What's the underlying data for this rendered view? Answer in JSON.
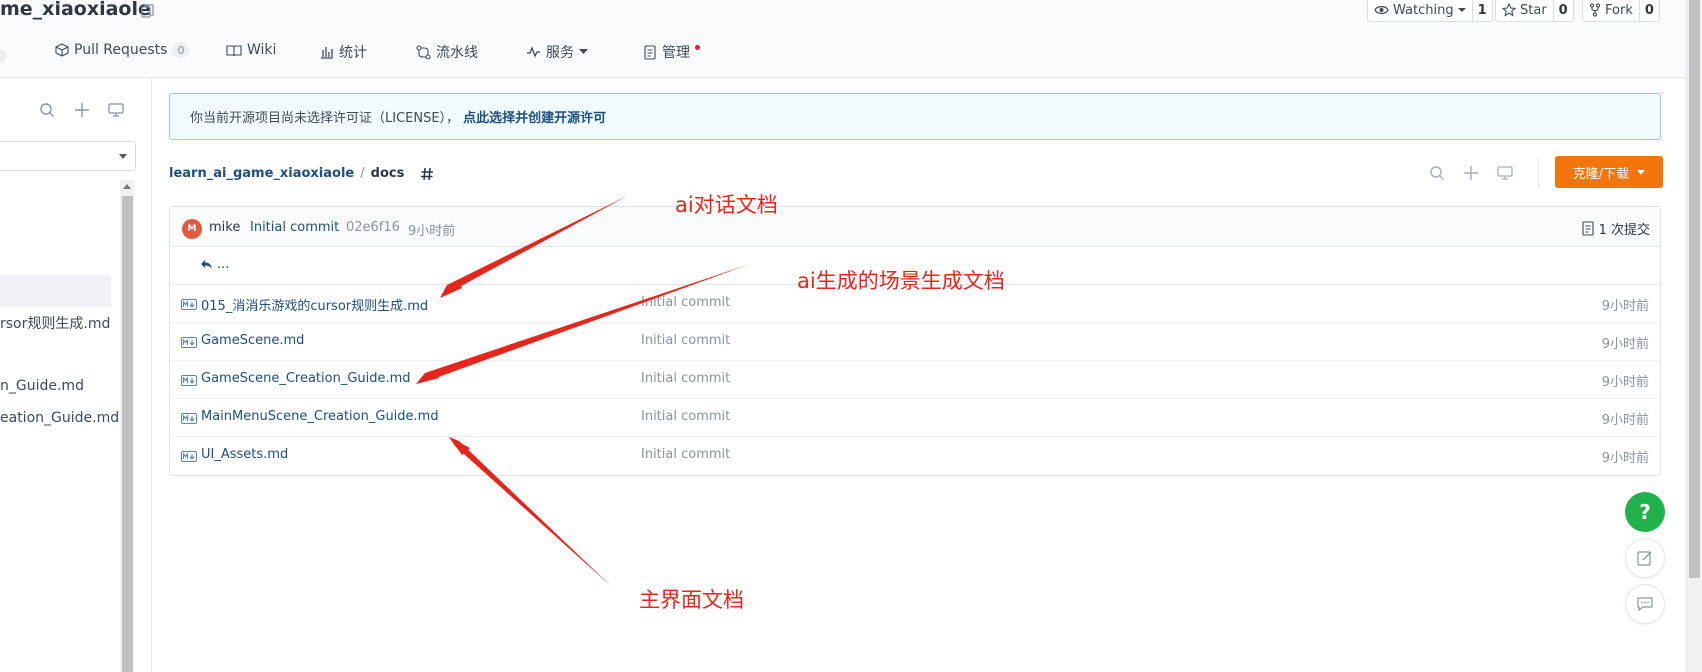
{
  "repo": {
    "title": "me_xiaoxiaole"
  },
  "header_buttons": {
    "watching": {
      "label": "Watching",
      "count": "1"
    },
    "star": {
      "label": "Star",
      "count": "0"
    },
    "fork": {
      "label": "Fork",
      "count": "0"
    }
  },
  "nav": {
    "pull_requests": {
      "label": "Pull Requests",
      "count": "0"
    },
    "wiki": "Wiki",
    "stats": "统计",
    "pipeline": "流水线",
    "services": "服务",
    "manage": "管理"
  },
  "sidebar": {
    "items": [
      "rsor规则生成.md",
      "n_Guide.md",
      "eation_Guide.md"
    ]
  },
  "notice": {
    "text": "你当前开源项目尚未选择许可证（LICENSE），",
    "link": "点此选择并创建开源许可"
  },
  "breadcrumb": {
    "repo": "learn_ai_game_xiaoxiaole",
    "separator": "/",
    "current": "docs"
  },
  "clone_button": "克隆/下载",
  "commit_bar": {
    "avatar_letter": "M",
    "author": "mike",
    "message": "Initial commit",
    "hash": "02e6f16",
    "time": "9小时前",
    "commit_count": "1 次提交"
  },
  "back_link": "...",
  "files": [
    {
      "name": "015_消消乐游戏的cursor规则生成.md",
      "message": "Initial commit",
      "time": "9小时前"
    },
    {
      "name": "GameScene.md",
      "message": "Initial commit",
      "time": "9小时前"
    },
    {
      "name": "GameScene_Creation_Guide.md",
      "message": "Initial commit",
      "time": "9小时前"
    },
    {
      "name": "MainMenuScene_Creation_Guide.md",
      "message": "Initial commit",
      "time": "9小时前"
    },
    {
      "name": "UI_Assets.md",
      "message": "Initial commit",
      "time": "9小时前"
    }
  ],
  "fab": {
    "help": "?"
  },
  "annotations": {
    "ai_dialog": "ai对话文档",
    "ai_scene": "ai生成的场景生成文档",
    "main_ui": "主界面文档"
  },
  "colors": {
    "link": "#1d4f80",
    "accent_orange": "#f3760c",
    "help_green": "#21b24b",
    "annotation_red": "#e8251b"
  }
}
